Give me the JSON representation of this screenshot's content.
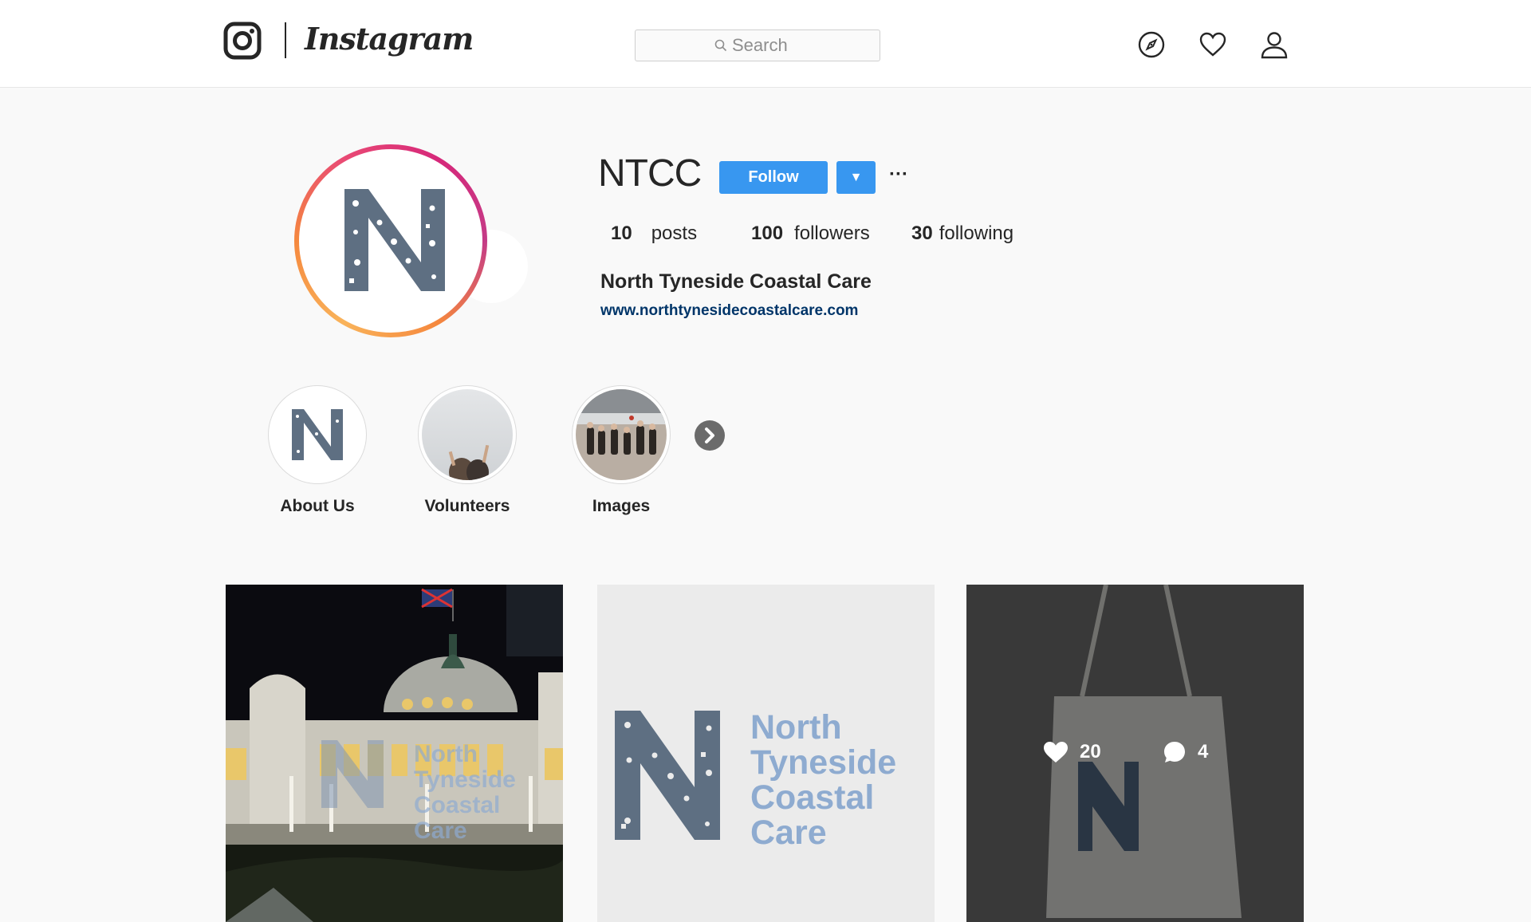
{
  "header": {
    "logo_icon": "instagram-camera-icon",
    "wordmark": "Instagram",
    "search_placeholder": "Search",
    "icons": [
      "compass-icon",
      "heart-icon",
      "user-icon"
    ]
  },
  "profile": {
    "username": "NTCC",
    "follow_label": "Follow",
    "dropdown_glyph": "▼",
    "more_glyph": "···",
    "stats": {
      "posts_count": "10",
      "posts_label": "posts",
      "followers_count": "100",
      "followers_label": "followers",
      "following_count": "30",
      "following_label": "following"
    },
    "full_name": "North Tyneside Coastal Care",
    "website": "www.northtynesidecoastalcare.com"
  },
  "highlights": [
    {
      "label": "About Us"
    },
    {
      "label": "Volunteers"
    },
    {
      "label": "Images"
    }
  ],
  "posts": [
    {
      "overlay_text": [
        "North",
        "Tyneside",
        "Coastal",
        "Care"
      ]
    },
    {
      "logo_text": [
        "North",
        "Tyneside",
        "Coastal",
        "Care"
      ]
    },
    {
      "likes": "20",
      "comments": "4"
    }
  ],
  "colors": {
    "accent_blue": "#3897f0",
    "link_blue": "#003569",
    "brand_slate": "#5e6f82",
    "brand_light_blue": "#8eabd0"
  }
}
